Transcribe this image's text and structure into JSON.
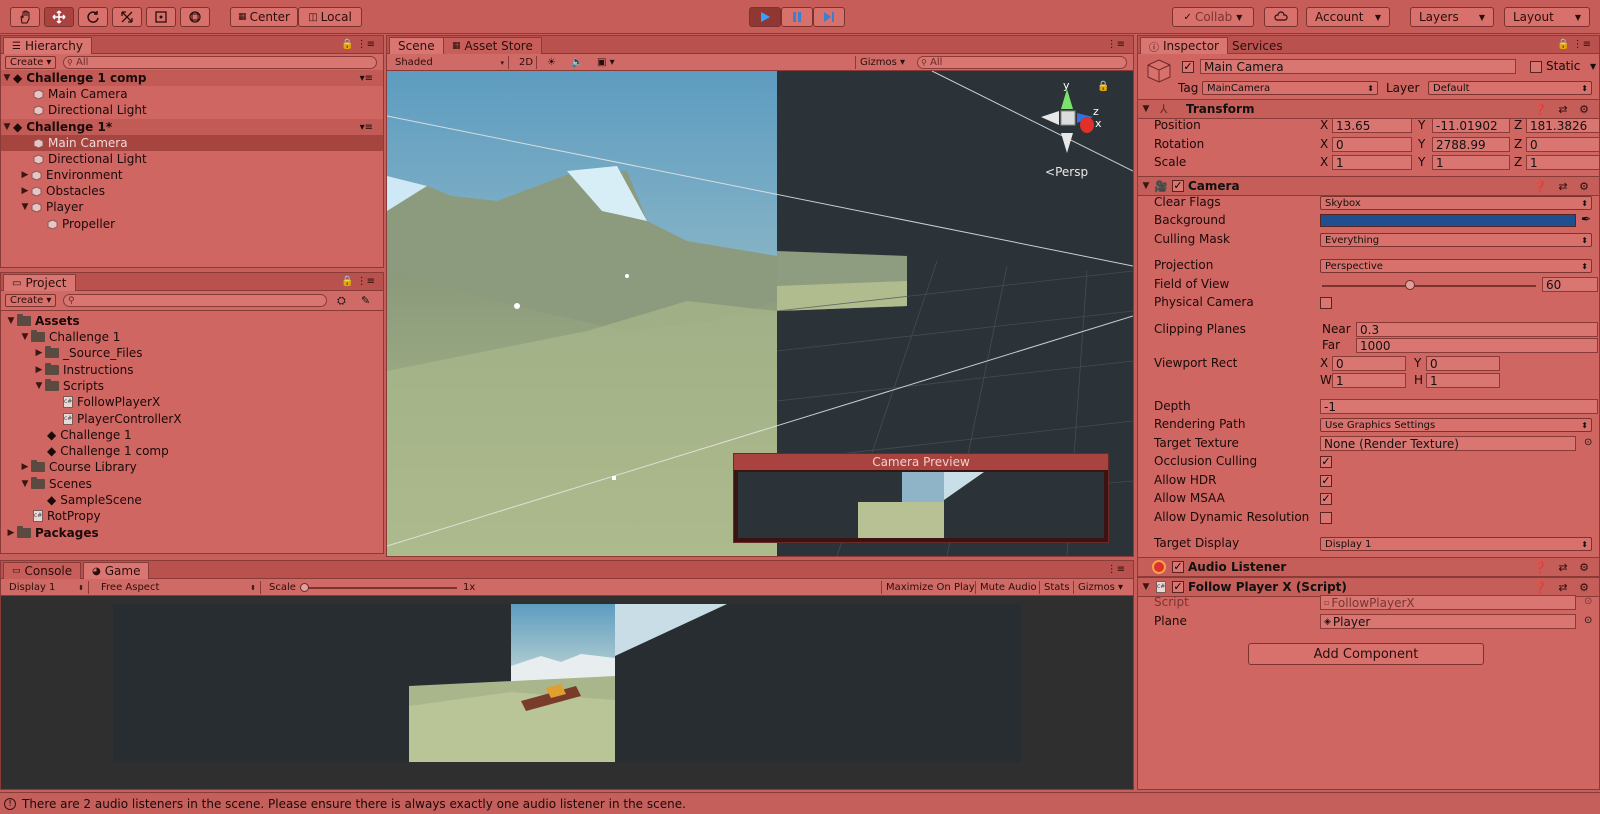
{
  "toolbar": {
    "tools": [
      "hand-icon",
      "move-icon",
      "rotate-icon",
      "scale-icon",
      "rect-icon",
      "transform-icon"
    ],
    "pivot": "Center",
    "space": "Local",
    "collab": "Collab",
    "account": "Account",
    "layers": "Layers",
    "layout": "Layout"
  },
  "hierarchy": {
    "tab": "Hierarchy",
    "create": "Create",
    "search_placeholder": "All",
    "items": [
      "Challenge 1 comp",
      "Main Camera",
      "Directional Light",
      "Challenge 1*",
      "Main Camera",
      "Directional Light",
      "Environment",
      "Obstacles",
      "Player",
      "Propeller"
    ]
  },
  "project": {
    "tab": "Project",
    "create": "Create",
    "items": [
      "Assets",
      "Challenge 1",
      "_Source_Files",
      "Instructions",
      "Scripts",
      "FollowPlayerX",
      "PlayerControllerX",
      "Challenge 1",
      "Challenge 1 comp",
      "Course Library",
      "Scenes",
      "SampleScene",
      "RotPropy",
      "Packages"
    ]
  },
  "scene": {
    "tabs": [
      "Scene",
      "Asset Store"
    ],
    "shading": "Shaded",
    "mode2d": "2D",
    "gizmos": "Gizmos",
    "search_placeholder": "All",
    "persp": "Persp",
    "gizmo_y": "y",
    "gizmo_z": "z",
    "gizmo_x": "x",
    "camera_preview": "Camera Preview"
  },
  "game": {
    "tabs": [
      "Console",
      "Game"
    ],
    "display": "Display 1",
    "aspect": "Free Aspect",
    "scale_label": "Scale",
    "scale_value": "1x",
    "maximize": "Maximize On Play",
    "mute": "Mute Audio",
    "stats": "Stats",
    "gizmos": "Gizmos"
  },
  "inspector": {
    "tabs": [
      "Inspector",
      "Services"
    ],
    "name": "Main Camera",
    "static": "Static",
    "tag_label": "Tag",
    "tag": "MainCamera",
    "layer_label": "Layer",
    "layer": "Default",
    "transform": {
      "title": "Transform",
      "position_label": "Position",
      "rotation_label": "Rotation",
      "scale_label": "Scale",
      "x": "X",
      "y": "Y",
      "z": "Z",
      "position": [
        "13.65",
        "-11.01902",
        "181.3826"
      ],
      "rotation": [
        "0",
        "2788.99",
        "0"
      ],
      "scale": [
        "1",
        "1",
        "1"
      ]
    },
    "camera": {
      "title": "Camera",
      "clear_flags_label": "Clear Flags",
      "clear_flags": "Skybox",
      "background_label": "Background",
      "background_color": "#1f4f8f",
      "culling_label": "Culling Mask",
      "culling": "Everything",
      "projection_label": "Projection",
      "projection": "Perspective",
      "fov_label": "Field of View",
      "fov": "60",
      "fov_fraction": 0.41,
      "physical_label": "Physical Camera",
      "clipping_label": "Clipping Planes",
      "near_label": "Near",
      "near": "0.3",
      "far_label": "Far",
      "far": "1000",
      "viewport_label": "Viewport Rect",
      "vx": "0",
      "vy": "0",
      "vw": "1",
      "vh": "1",
      "w": "W",
      "h": "H",
      "depth_label": "Depth",
      "depth": "-1",
      "render_path_label": "Rendering Path",
      "render_path": "Use Graphics Settings",
      "target_tex_label": "Target Texture",
      "target_tex": "None (Render Texture)",
      "occlusion_label": "Occlusion Culling",
      "hdr_label": "Allow HDR",
      "msaa_label": "Allow MSAA",
      "dyn_res_label": "Allow Dynamic Resolution",
      "target_display_label": "Target Display",
      "target_display": "Display 1"
    },
    "audio_listener": "Audio Listener",
    "follow": {
      "title": "Follow Player X (Script)",
      "script_label": "Script",
      "script": "FollowPlayerX",
      "plane_label": "Plane",
      "plane": "Player"
    },
    "add_component": "Add Component"
  },
  "status": {
    "message": "There are 2 audio listeners in the scene. Please ensure there is always exactly one audio listener in the scene."
  }
}
